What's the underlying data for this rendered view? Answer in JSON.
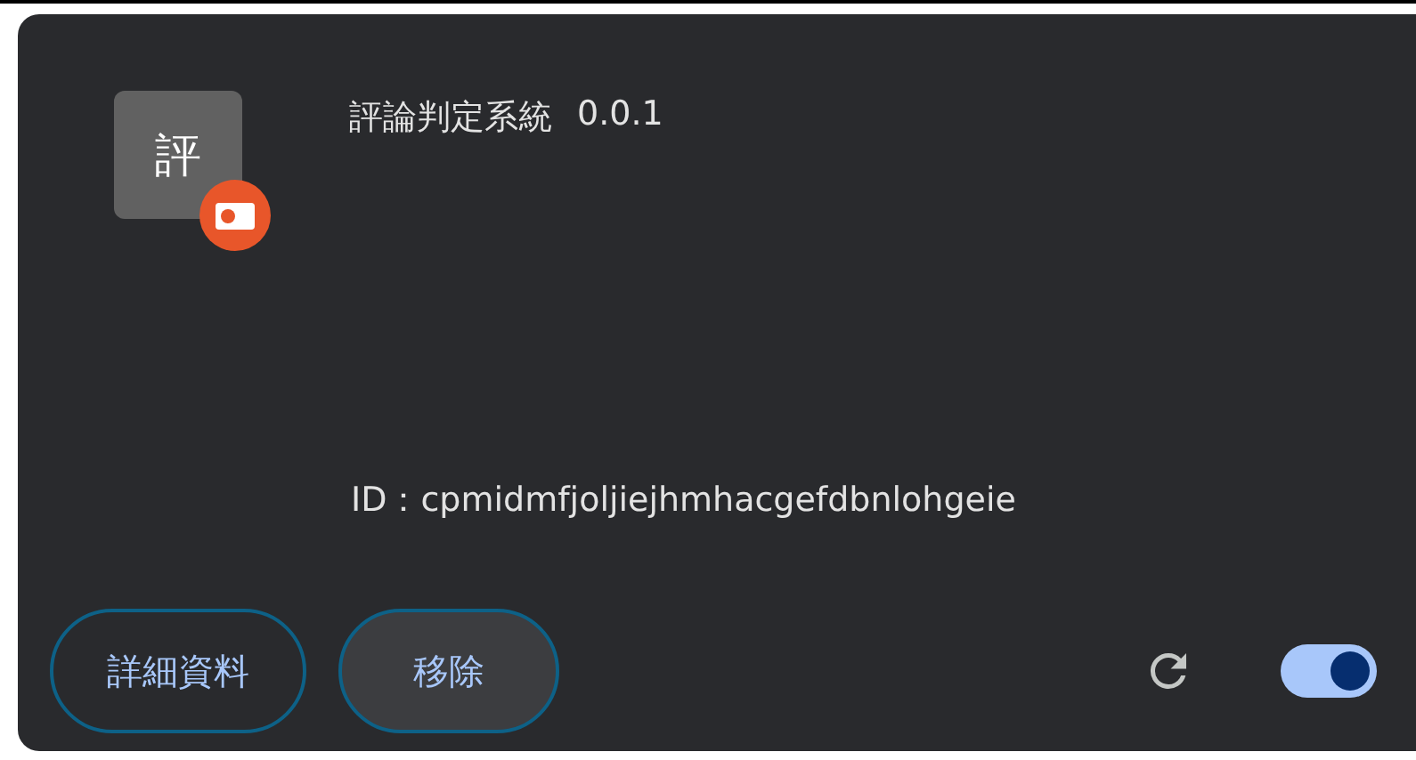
{
  "extension": {
    "icon_text": "評",
    "name": "評論判定系統",
    "version": "0.0.1",
    "id": "ID：cpmidmfjoljiejhmhacgefdbnlohgeie",
    "enabled": true
  },
  "buttons": [
    {
      "label": "詳細資料",
      "kind": "outline"
    },
    {
      "label": "移除",
      "kind": "filled"
    }
  ]
}
